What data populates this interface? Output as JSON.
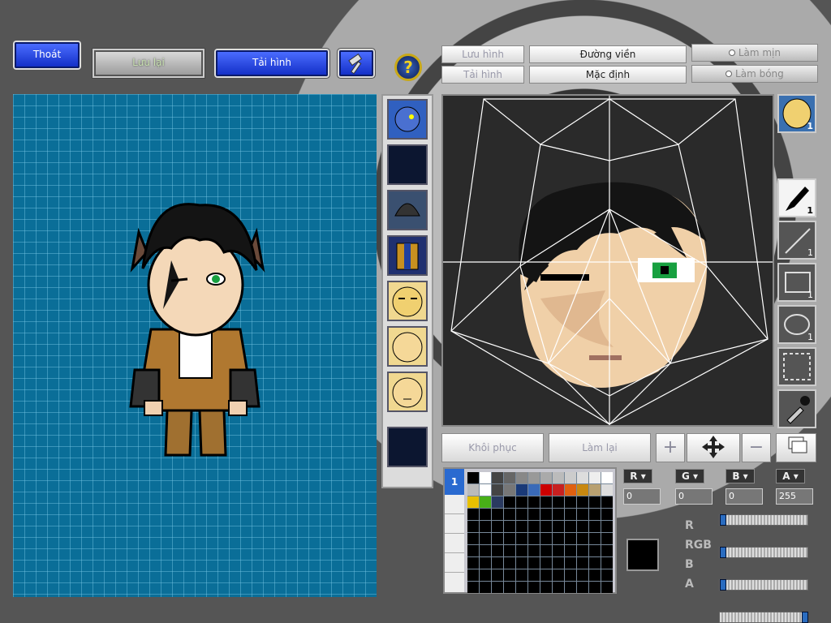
{
  "toolbar_left": {
    "exit_label": "Thoát",
    "save_label": "Lưu lại",
    "upload_label": "Tải hình",
    "help_glyph": "?"
  },
  "toolbar_right": {
    "save_label": "Lưu hình",
    "upload_label": "Tải hình",
    "outline_label": "Đường viền",
    "default_label": "Mặc định",
    "smooth_label": "Làm mịn",
    "shade_label": "Làm bóng"
  },
  "tools": {
    "pen_size": "1",
    "line_size": "1",
    "rect_size": "1",
    "ellipse_size": "1",
    "layer_number": "1"
  },
  "actions": {
    "restore_label": "Khôi phục",
    "redo_label": "Làm lại",
    "zoom_in": "+",
    "zoom_out": "−"
  },
  "palette": {
    "tab_number": "1",
    "colors": [
      "#000000",
      "#ffffff",
      "#444444",
      "#666666",
      "#888888",
      "#999999",
      "#aaaaaa",
      "#bbbbbb",
      "#cccccc",
      "#dddddd",
      "#eeeeee",
      "#ffffff",
      "#bbbbbb",
      "#ffffff",
      "#444444",
      "#777777",
      "#1a3a78",
      "#3a6ab8",
      "#cc0000",
      "#c82020",
      "#e06010",
      "#c88810",
      "#b8a070",
      "#dddddd",
      "#e8c000",
      "#48b018",
      "#2a3a60"
    ]
  },
  "color": {
    "r_label": "R",
    "g_label": "G",
    "b_label": "B",
    "a_label": "A",
    "r": "0",
    "g": "0",
    "b": "0",
    "a": "255",
    "current": "#000000"
  },
  "colors_theme": {
    "accent_blue": "#1430c8",
    "grid_blue": "#0a6e98"
  }
}
